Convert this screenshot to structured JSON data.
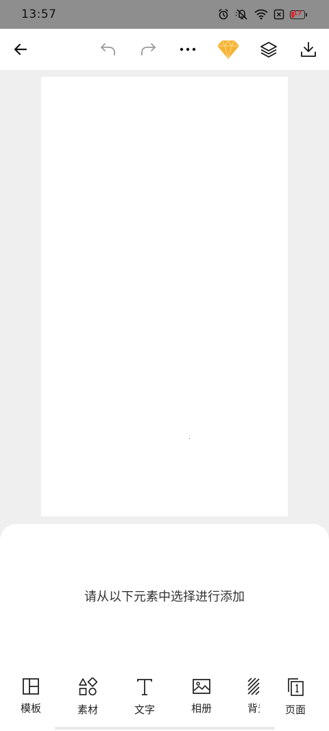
{
  "status_bar": {
    "time": "13:57",
    "icons": [
      "alarm-icon",
      "mute-icon",
      "wifi-icon",
      "sim-disabled-icon"
    ],
    "battery_level": "17",
    "battery_color": "#e0262e"
  },
  "toolbar": {
    "buttons": [
      "back-icon",
      "undo-icon",
      "redo-icon",
      "more-icon",
      "vip-diamond-icon",
      "layers-icon",
      "download-icon"
    ],
    "accent": "#f6a623"
  },
  "sheet": {
    "hint": "请从以下元素中选择进行添加"
  },
  "tabs": [
    {
      "label": "模板",
      "icon": "template-icon"
    },
    {
      "label": "素材",
      "icon": "shapes-icon"
    },
    {
      "label": "文字",
      "icon": "text-icon"
    },
    {
      "label": "相册",
      "icon": "image-icon"
    },
    {
      "label": "背景",
      "icon": "background-icon"
    },
    {
      "label": "页面",
      "icon": "page-icon"
    }
  ]
}
